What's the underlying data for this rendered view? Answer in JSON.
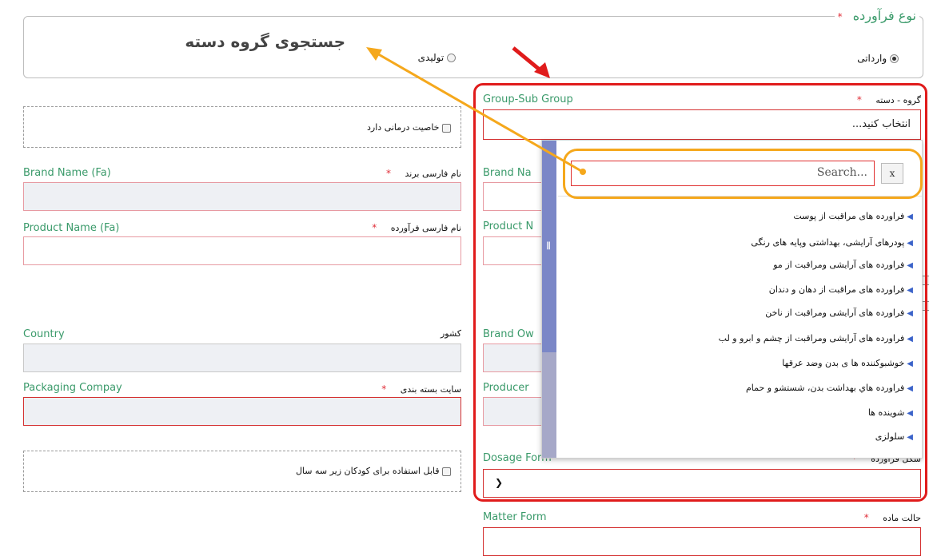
{
  "product_type": {
    "legend": "نوع فرآورده",
    "options": [
      {
        "label": "وارداتی",
        "selected": true
      },
      {
        "label": "تولیدی",
        "selected": false
      }
    ],
    "annotation": "جستجوی گروه دسته"
  },
  "left": {
    "therapeutic_label": "خاصیت درمانی دارد",
    "brand_fa": {
      "en": "Brand Name (Fa)",
      "fa": "نام فارسی برند"
    },
    "product_fa": {
      "en": "Product Name (Fa)",
      "fa": "نام فارسی فرآورده"
    },
    "country": {
      "en": "Country",
      "fa": "کشور"
    },
    "packaging": {
      "en": "Packaging Compay",
      "fa": "سایت بسته بندی"
    },
    "kids_label": "قابل استفاده برای کودکان زیر سه سال"
  },
  "right": {
    "group": {
      "en": "Group-Sub Group",
      "fa": "گروه - دسته",
      "value": "انتخاب کنید..."
    },
    "brand_name_partial": "Brand Na",
    "product_name_partial": "Product N",
    "brand_owner_partial": "Brand Ow",
    "producer_partial": "Producer",
    "dosage": {
      "en": "Dosage Form",
      "fa": "شکل فرآورده"
    },
    "matter": {
      "en": "Matter Form",
      "fa": "حالت ماده"
    }
  },
  "dropdown": {
    "search_placeholder": "Search...",
    "clear_label": "x",
    "items": [
      "فراورده های مراقبت از پوست",
      "پودرهای آرایشی، بهداشتی وپایه های رنگی",
      "فراورده های آرایشی ومراقبت از مو",
      "فراورده های مراقبت از دهان و دندان",
      "فراورده های آرایشی ومراقبت از ناخن",
      "فراورده های آرایشی ومراقبت از چشم و ابرو و لب",
      "خوشبوکننده ها ی بدن وضد عرقها",
      "فراورده هاي بهداشت بدن، شستشو و حمام",
      "شوینده ها",
      "سلولزی"
    ]
  },
  "colors": {
    "highlight_red": "#e01b1b",
    "highlight_orange": "#f5a81c",
    "label_green": "#3a9a6a"
  }
}
